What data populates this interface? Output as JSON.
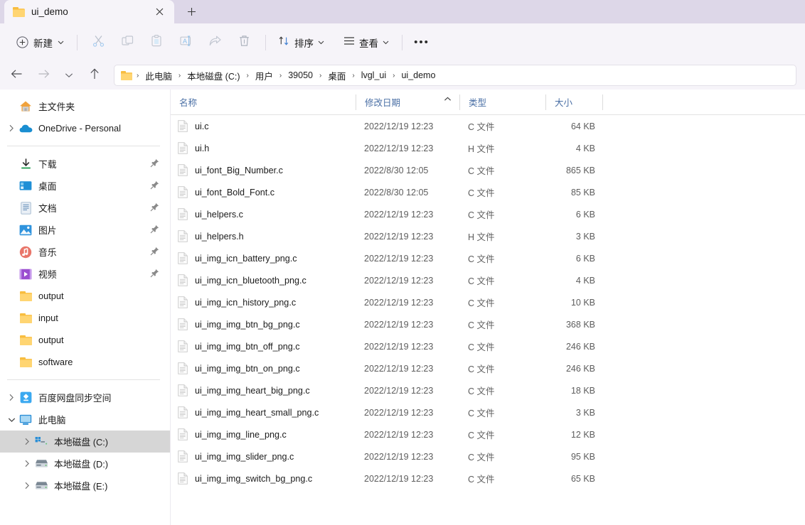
{
  "window": {
    "tab": {
      "title": "ui_demo",
      "folder_icon": "folder-icon",
      "close_icon": "close-icon"
    },
    "new_tab_label": "+"
  },
  "toolbar": {
    "new_label": "新建",
    "new_icon": "plus-circle-icon",
    "chevron_icon": "chevron-down-icon",
    "cut_icon": "cut-icon",
    "copy_icon": "copy-icon",
    "paste_icon": "paste-icon",
    "rename_icon": "rename-icon",
    "share_icon": "share-icon",
    "delete_icon": "delete-icon",
    "sort_label": "排序",
    "sort_icon": "sort-icon",
    "view_label": "查看",
    "view_icon": "view-list-icon",
    "more_label": "•••"
  },
  "addressbar": {
    "back_icon": "arrow-left-icon",
    "forward_icon": "arrow-right-icon",
    "recent_icon": "chevron-down-icon",
    "up_icon": "arrow-up-icon",
    "folder_icon": "folder-icon",
    "separator": "›",
    "crumbs": [
      "此电脑",
      "本地磁盘 (C:)",
      "用户",
      "39050",
      "桌面",
      "lvgl_ui",
      "ui_demo"
    ]
  },
  "sidebar": {
    "groups": [
      {
        "items": [
          {
            "label": "主文件夹",
            "icon": "home-icon",
            "chevron": false,
            "pin": false,
            "indent": 0,
            "selected": false
          },
          {
            "label": "OneDrive - Personal",
            "icon": "cloud-icon",
            "chevron": true,
            "pin": false,
            "indent": 0,
            "selected": false
          }
        ]
      },
      {
        "items": [
          {
            "label": "下载",
            "icon": "download-icon",
            "chevron": false,
            "pin": true,
            "indent": 0,
            "selected": false
          },
          {
            "label": "桌面",
            "icon": "desktop-icon",
            "chevron": false,
            "pin": true,
            "indent": 0,
            "selected": false
          },
          {
            "label": "文档",
            "icon": "document-icon",
            "chevron": false,
            "pin": true,
            "indent": 0,
            "selected": false
          },
          {
            "label": "图片",
            "icon": "pictures-icon",
            "chevron": false,
            "pin": true,
            "indent": 0,
            "selected": false
          },
          {
            "label": "音乐",
            "icon": "music-icon",
            "chevron": false,
            "pin": true,
            "indent": 0,
            "selected": false
          },
          {
            "label": "视频",
            "icon": "video-icon",
            "chevron": false,
            "pin": true,
            "indent": 0,
            "selected": false
          },
          {
            "label": "output",
            "icon": "folder-icon",
            "chevron": false,
            "pin": false,
            "indent": 0,
            "selected": false
          },
          {
            "label": "input",
            "icon": "folder-icon",
            "chevron": false,
            "pin": false,
            "indent": 0,
            "selected": false
          },
          {
            "label": "output",
            "icon": "folder-icon",
            "chevron": false,
            "pin": false,
            "indent": 0,
            "selected": false
          },
          {
            "label": "software",
            "icon": "folder-icon",
            "chevron": false,
            "pin": false,
            "indent": 0,
            "selected": false
          }
        ]
      },
      {
        "items": [
          {
            "label": "百度网盘同步空间",
            "icon": "baidu-netdisk-icon",
            "chevron": true,
            "pin": false,
            "indent": 0,
            "selected": false
          },
          {
            "label": "此电脑",
            "icon": "this-pc-icon",
            "chevron": true,
            "expanded": true,
            "pin": false,
            "indent": 0,
            "selected": false
          },
          {
            "label": "本地磁盘 (C:)",
            "icon": "windows-drive-icon",
            "chevron": true,
            "pin": false,
            "indent": 1,
            "selected": true
          },
          {
            "label": "本地磁盘 (D:)",
            "icon": "drive-icon",
            "chevron": true,
            "pin": false,
            "indent": 1,
            "selected": false
          },
          {
            "label": "本地磁盘 (E:)",
            "icon": "drive-icon",
            "chevron": true,
            "pin": false,
            "indent": 1,
            "selected": false
          }
        ]
      }
    ]
  },
  "filelist": {
    "columns": [
      {
        "label": "名称",
        "key": "name"
      },
      {
        "label": "修改日期",
        "key": "date"
      },
      {
        "label": "类型",
        "key": "type"
      },
      {
        "label": "大小",
        "key": "size"
      }
    ],
    "sort_column": "名称",
    "sort_direction": "asc",
    "files": [
      {
        "name": "ui.c",
        "date": "2022/12/19 12:23",
        "type": "C 文件",
        "size": "64 KB"
      },
      {
        "name": "ui.h",
        "date": "2022/12/19 12:23",
        "type": "H 文件",
        "size": "4 KB"
      },
      {
        "name": "ui_font_Big_Number.c",
        "date": "2022/8/30 12:05",
        "type": "C 文件",
        "size": "865 KB"
      },
      {
        "name": "ui_font_Bold_Font.c",
        "date": "2022/8/30 12:05",
        "type": "C 文件",
        "size": "85 KB"
      },
      {
        "name": "ui_helpers.c",
        "date": "2022/12/19 12:23",
        "type": "C 文件",
        "size": "6 KB"
      },
      {
        "name": "ui_helpers.h",
        "date": "2022/12/19 12:23",
        "type": "H 文件",
        "size": "3 KB"
      },
      {
        "name": "ui_img_icn_battery_png.c",
        "date": "2022/12/19 12:23",
        "type": "C 文件",
        "size": "6 KB"
      },
      {
        "name": "ui_img_icn_bluetooth_png.c",
        "date": "2022/12/19 12:23",
        "type": "C 文件",
        "size": "4 KB"
      },
      {
        "name": "ui_img_icn_history_png.c",
        "date": "2022/12/19 12:23",
        "type": "C 文件",
        "size": "10 KB"
      },
      {
        "name": "ui_img_img_btn_bg_png.c",
        "date": "2022/12/19 12:23",
        "type": "C 文件",
        "size": "368 KB"
      },
      {
        "name": "ui_img_img_btn_off_png.c",
        "date": "2022/12/19 12:23",
        "type": "C 文件",
        "size": "246 KB"
      },
      {
        "name": "ui_img_img_btn_on_png.c",
        "date": "2022/12/19 12:23",
        "type": "C 文件",
        "size": "246 KB"
      },
      {
        "name": "ui_img_img_heart_big_png.c",
        "date": "2022/12/19 12:23",
        "type": "C 文件",
        "size": "18 KB"
      },
      {
        "name": "ui_img_img_heart_small_png.c",
        "date": "2022/12/19 12:23",
        "type": "C 文件",
        "size": "3 KB"
      },
      {
        "name": "ui_img_img_line_png.c",
        "date": "2022/12/19 12:23",
        "type": "C 文件",
        "size": "12 KB"
      },
      {
        "name": "ui_img_img_slider_png.c",
        "date": "2022/12/19 12:23",
        "type": "C 文件",
        "size": "95 KB"
      },
      {
        "name": "ui_img_img_switch_bg_png.c",
        "date": "2022/12/19 12:23",
        "type": "C 文件",
        "size": "65 KB"
      }
    ]
  },
  "colors": {
    "titlebar": "#ddd7e8",
    "toolbar": "#f6f4f9",
    "tab_active": "#f6f4f9",
    "content": "#ffffff",
    "column_header_text": "#4a6fa5",
    "selection": "#d6d6d6",
    "folder_yellow": "#ffd572"
  }
}
